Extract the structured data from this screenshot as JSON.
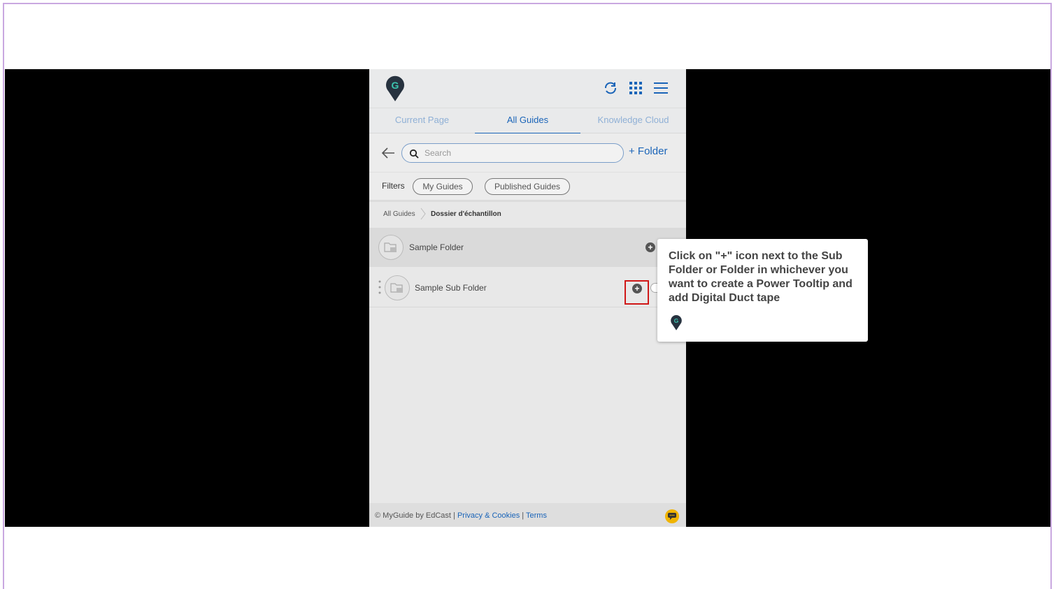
{
  "header": {
    "icons": [
      "sync-icon",
      "apps-grid-icon",
      "hamburger-menu-icon"
    ],
    "accent_color": "#1a64b8"
  },
  "tabs": [
    {
      "label": "Current Page"
    },
    {
      "label": "All Guides"
    },
    {
      "label": "Knowledge Cloud"
    }
  ],
  "search": {
    "placeholder": "Search",
    "add_folder_label": "+ Folder"
  },
  "filters": {
    "label": "Filters",
    "chips": [
      "My Guides",
      "Published Guides"
    ]
  },
  "breadcrumb": {
    "root": "All Guides",
    "current": "Dossier d'échantillon"
  },
  "folders": [
    {
      "name": "Sample Folder"
    },
    {
      "name": "Sample Sub Folder"
    }
  ],
  "footer": {
    "copyright": "© MyGuide by EdCast",
    "sep": " | ",
    "privacy": "Privacy & Cookies",
    "terms": "Terms"
  },
  "tooltip": {
    "text": "Click on \"+\" icon next to the Sub Folder or Folder in whichever you want to create a Power Tooltip and add Digital Duct tape",
    "highlight_color": "#d01818"
  }
}
